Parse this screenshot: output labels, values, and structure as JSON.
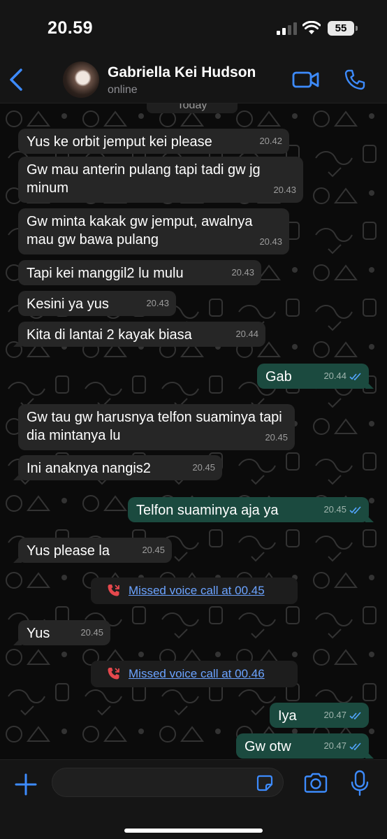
{
  "status_bar": {
    "time": "20.59",
    "battery": "55"
  },
  "header": {
    "contact_name": "Gabriella Kei Hudson",
    "status": "online"
  },
  "chat": {
    "day_label": "Today",
    "messages": [
      {
        "text": "Yus ke orbit jemput kei please",
        "time": "20.42",
        "direction": "in"
      },
      {
        "text": "Gw mau anterin pulang tapi tadi gw jg minum",
        "time": "20.43",
        "direction": "in"
      },
      {
        "text": "Gw minta kakak gw jemput, awalnya mau gw bawa pulang",
        "time": "20.43",
        "direction": "in"
      },
      {
        "text": "Tapi kei manggil2 lu mulu",
        "time": "20.43",
        "direction": "in"
      },
      {
        "text": "Kesini ya yus",
        "time": "20.43",
        "direction": "in"
      },
      {
        "text": "Kita di lantai 2 kayak biasa",
        "time": "20.44",
        "direction": "in"
      },
      {
        "text": "Gab",
        "time": "20.44",
        "direction": "out",
        "status": "read"
      },
      {
        "text": "Gw tau gw harusnya telfon suaminya tapi dia mintanya lu",
        "time": "20.45",
        "direction": "in"
      },
      {
        "text": "Ini anaknya nangis2",
        "time": "20.45",
        "direction": "in"
      },
      {
        "text": "Telfon suaminya aja ya",
        "time": "20.45",
        "direction": "out",
        "status": "read"
      },
      {
        "text": "Yus please la",
        "time": "20.45",
        "direction": "in"
      },
      {
        "text": "Yus",
        "time": "20.45",
        "direction": "in"
      },
      {
        "text": "Iya",
        "time": "20.47",
        "direction": "out",
        "status": "read"
      },
      {
        "text": "Gw otw",
        "time": "20.47",
        "direction": "out",
        "status": "read"
      }
    ],
    "missed_calls": [
      {
        "text": "Missed voice call at 00.45"
      },
      {
        "text": "Missed voice call at 00.46"
      }
    ]
  },
  "input": {
    "placeholder": ""
  },
  "colors": {
    "accent": "#3d8bfd",
    "incoming_bubble": "#262626",
    "outgoing_bubble": "#1b4a3f",
    "missed_call_icon": "#e5484d",
    "read_tick": "#53a6ff"
  },
  "icons": {
    "back": "chevron-left-icon",
    "video": "video-camera-icon",
    "call": "phone-icon",
    "attach": "plus-icon",
    "sticker": "sticker-icon",
    "camera": "camera-icon",
    "voice": "microphone-icon",
    "missed_call": "missed-call-icon",
    "read": "double-check-icon"
  }
}
